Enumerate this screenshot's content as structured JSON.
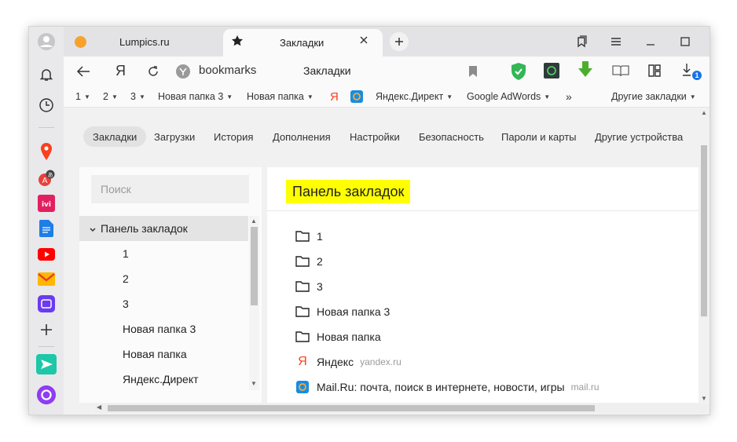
{
  "tabs": [
    {
      "title": "Lumpics.ru",
      "active": false
    },
    {
      "title": "Закладки",
      "active": true
    }
  ],
  "address": {
    "text": "bookmarks",
    "page_title": "Закладки"
  },
  "bookmarks_bar": {
    "items": [
      "1",
      "2",
      "3",
      "Новая папка 3",
      "Новая папка"
    ],
    "yandex_glyph": "Я",
    "direct_label": "Яндекс.Директ",
    "adwords_label": "Google AdWords",
    "more_glyph": "»",
    "other_label": "Другие закладки"
  },
  "nav_tabs": [
    "Закладки",
    "Загрузки",
    "История",
    "Дополнения",
    "Настройки",
    "Безопасность",
    "Пароли и карты",
    "Другие устройства"
  ],
  "sidebar": {
    "search_placeholder": "Поиск",
    "root": "Панель закладок",
    "children": [
      "1",
      "2",
      "3",
      "Новая папка 3",
      "Новая папка",
      "Яндекс.Директ"
    ]
  },
  "main": {
    "title": "Панель закладок",
    "folders": [
      "1",
      "2",
      "3",
      "Новая папка 3",
      "Новая папка"
    ],
    "links": [
      {
        "title": "Яндекс",
        "url": "yandex.ru"
      },
      {
        "title": "Mail.Ru: почта, поиск в интернете, новости, игры",
        "url": "mail.ru"
      }
    ]
  },
  "downloads_badge": "1",
  "colors": {
    "highlight": "#ffff00",
    "yandex_red": "#fc3f1d",
    "mail_blue": "#168de2",
    "shield_green": "#34b558"
  }
}
